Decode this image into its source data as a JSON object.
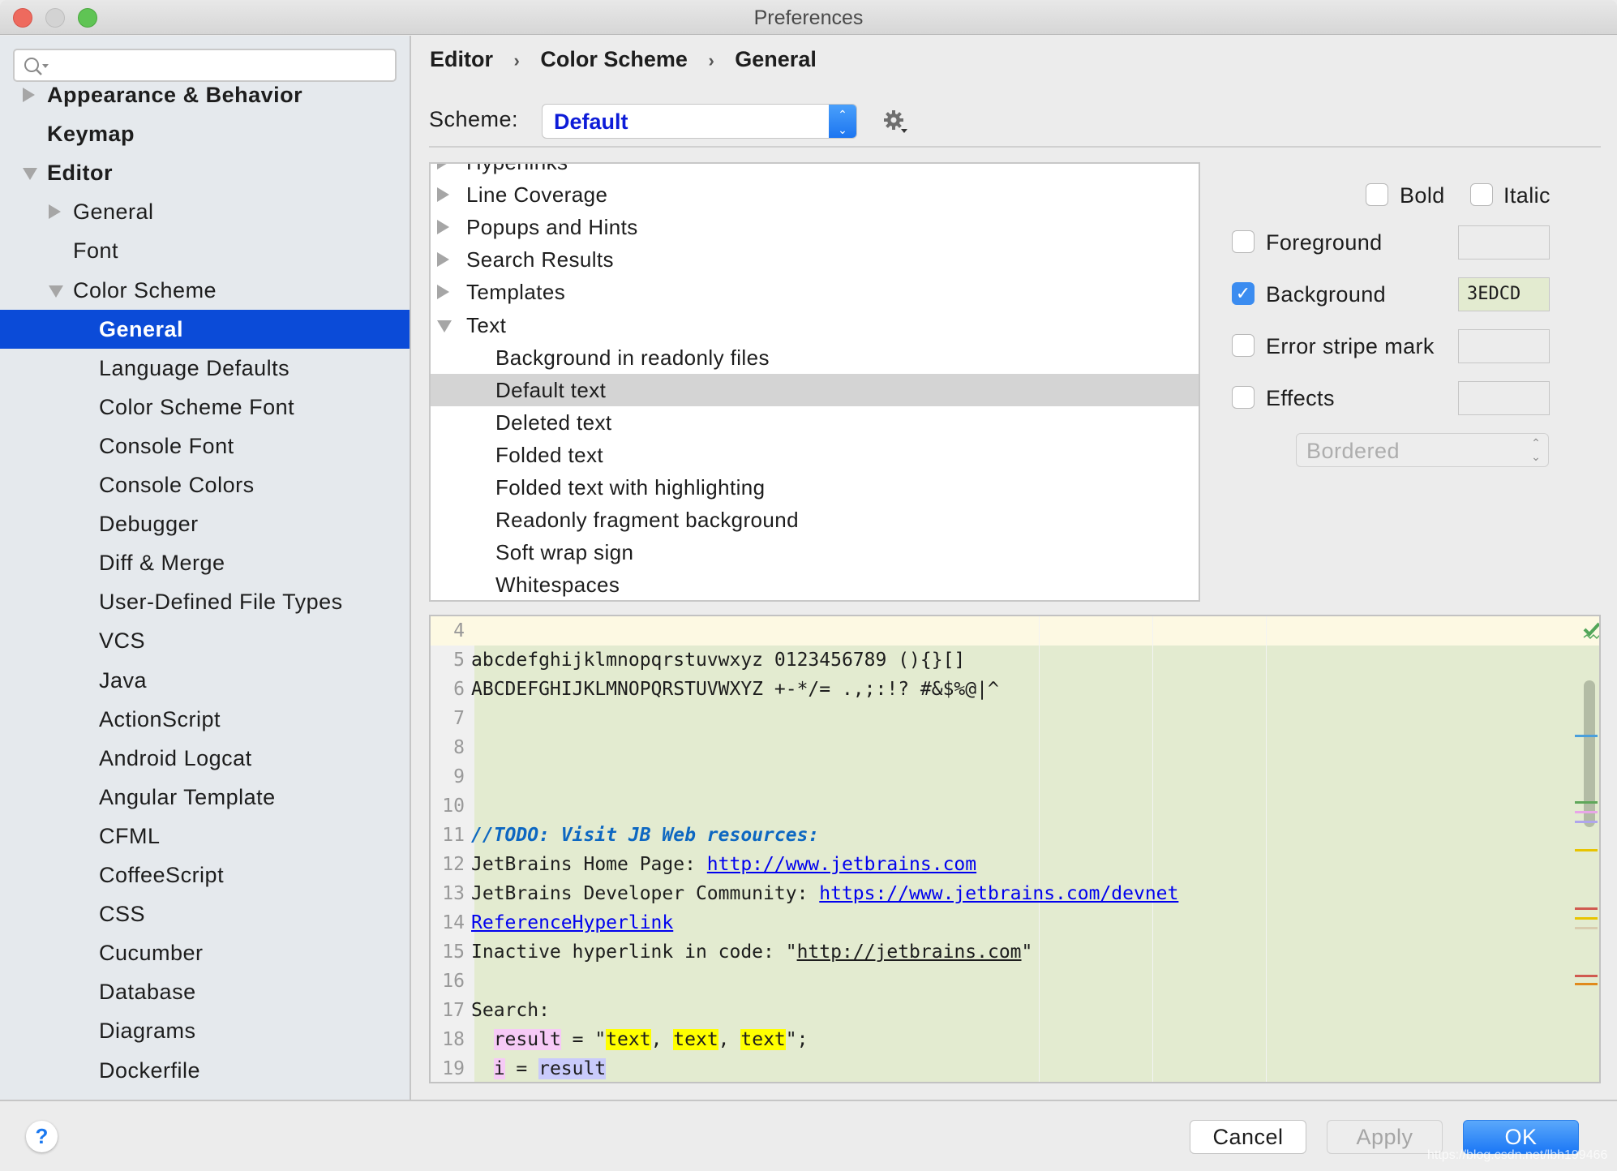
{
  "window": {
    "title": "Preferences",
    "traffic_lights": {
      "close": "#ee6a5e",
      "minimize": "#d3d3d3",
      "zoom": "#5fc454"
    }
  },
  "sidebar": {
    "search": {
      "placeholder": "",
      "value": "",
      "icon": "search-icon"
    },
    "items": [
      {
        "label": "Appearance & Behavior",
        "level": 0,
        "bold": true,
        "expander": "collapsed"
      },
      {
        "label": "Keymap",
        "level": 0,
        "bold": true,
        "expander": "none"
      },
      {
        "label": "Editor",
        "level": 0,
        "bold": true,
        "expander": "expanded"
      },
      {
        "label": "General",
        "level": 1,
        "bold": false,
        "expander": "collapsed"
      },
      {
        "label": "Font",
        "level": 1,
        "bold": false,
        "expander": "none"
      },
      {
        "label": "Color Scheme",
        "level": 1,
        "bold": false,
        "expander": "expanded"
      },
      {
        "label": "General",
        "level": 2,
        "bold": false,
        "expander": "none",
        "selected": true
      },
      {
        "label": "Language Defaults",
        "level": 2,
        "expander": "none"
      },
      {
        "label": "Color Scheme Font",
        "level": 2,
        "expander": "none"
      },
      {
        "label": "Console Font",
        "level": 2,
        "expander": "none"
      },
      {
        "label": "Console Colors",
        "level": 2,
        "expander": "none"
      },
      {
        "label": "Debugger",
        "level": 2,
        "expander": "none"
      },
      {
        "label": "Diff & Merge",
        "level": 2,
        "expander": "none"
      },
      {
        "label": "User-Defined File Types",
        "level": 2,
        "expander": "none"
      },
      {
        "label": "VCS",
        "level": 2,
        "expander": "none"
      },
      {
        "label": "Java",
        "level": 2,
        "expander": "none"
      },
      {
        "label": "ActionScript",
        "level": 2,
        "expander": "none"
      },
      {
        "label": "Android Logcat",
        "level": 2,
        "expander": "none"
      },
      {
        "label": "Angular Template",
        "level": 2,
        "expander": "none"
      },
      {
        "label": "CFML",
        "level": 2,
        "expander": "none"
      },
      {
        "label": "CoffeeScript",
        "level": 2,
        "expander": "none"
      },
      {
        "label": "CSS",
        "level": 2,
        "expander": "none"
      },
      {
        "label": "Cucumber",
        "level": 2,
        "expander": "none"
      },
      {
        "label": "Database",
        "level": 2,
        "expander": "none"
      },
      {
        "label": "Diagrams",
        "level": 2,
        "expander": "none"
      },
      {
        "label": "Dockerfile",
        "level": 2,
        "expander": "none"
      }
    ],
    "selected_color": "#0b4bd8"
  },
  "breadcrumb": [
    "Editor",
    "Color Scheme",
    "General"
  ],
  "breadcrumb_separator": "›",
  "scheme": {
    "label": "Scheme:",
    "value": "Default",
    "value_color": "#0d1cd8"
  },
  "tree": {
    "rows": [
      {
        "label": "Hyperlinks",
        "level": 0,
        "expander": "collapsed",
        "partial": true
      },
      {
        "label": "Line Coverage",
        "level": 0,
        "expander": "collapsed"
      },
      {
        "label": "Popups and Hints",
        "level": 0,
        "expander": "collapsed"
      },
      {
        "label": "Search Results",
        "level": 0,
        "expander": "collapsed"
      },
      {
        "label": "Templates",
        "level": 0,
        "expander": "collapsed"
      },
      {
        "label": "Text",
        "level": 0,
        "expander": "expanded"
      },
      {
        "label": "Background in readonly files",
        "level": 1
      },
      {
        "label": "Default text",
        "level": 1,
        "selected": true
      },
      {
        "label": "Deleted text",
        "level": 1
      },
      {
        "label": "Folded text",
        "level": 1
      },
      {
        "label": "Folded text with highlighting",
        "level": 1
      },
      {
        "label": "Readonly fragment background",
        "level": 1
      },
      {
        "label": "Soft wrap sign",
        "level": 1
      },
      {
        "label": "Whitespaces",
        "level": 1
      }
    ]
  },
  "properties": {
    "bold": {
      "label": "Bold",
      "checked": false
    },
    "italic": {
      "label": "Italic",
      "checked": false
    },
    "foreground": {
      "label": "Foreground",
      "checked": false,
      "value": ""
    },
    "background": {
      "label": "Background",
      "checked": true,
      "value": "3EDCD",
      "color": "#e3ebd0"
    },
    "error_stripe": {
      "label": "Error stripe mark",
      "checked": false,
      "value": ""
    },
    "effects": {
      "label": "Effects",
      "checked": false,
      "value": ""
    },
    "effect_type": {
      "value": "Bordered",
      "disabled": true
    }
  },
  "preview": {
    "background": "#e3ebd0",
    "current_line_bg": "#fdf9e3",
    "lines": [
      {
        "n": "4",
        "segments": []
      },
      {
        "n": "5",
        "segments": [
          {
            "t": "abcdefghijklmnopqrstuvwxyz 0123456789 (){}[]",
            "s": ""
          }
        ]
      },
      {
        "n": "6",
        "segments": [
          {
            "t": "ABCDEFGHIJKLMNOPQRSTUVWXYZ +-*/= .,;:!? #&$%@|^",
            "s": ""
          }
        ]
      },
      {
        "n": "7",
        "segments": []
      },
      {
        "n": "8",
        "segments": []
      },
      {
        "n": "9",
        "segments": []
      },
      {
        "n": "10",
        "segments": []
      },
      {
        "n": "11",
        "segments": [
          {
            "t": "//TODO: Visit JB Web resources:",
            "s": "todo"
          }
        ]
      },
      {
        "n": "12",
        "segments": [
          {
            "t": "JetBrains Home Page: ",
            "s": ""
          },
          {
            "t": "http://www.jetbrains.com",
            "s": "lnk"
          }
        ]
      },
      {
        "n": "13",
        "segments": [
          {
            "t": "JetBrains Developer Community: ",
            "s": ""
          },
          {
            "t": "https://www.jetbrains.com/devnet",
            "s": "lnk"
          }
        ]
      },
      {
        "n": "14",
        "segments": [
          {
            "t": "ReferenceHyperlink",
            "s": "lnk"
          }
        ]
      },
      {
        "n": "15",
        "segments": [
          {
            "t": "Inactive hyperlink in code: \"",
            "s": ""
          },
          {
            "t": "http://jetbrains.com",
            "s": "ilnk"
          },
          {
            "t": "\"",
            "s": ""
          }
        ]
      },
      {
        "n": "16",
        "segments": []
      },
      {
        "n": "17",
        "segments": [
          {
            "t": "Search:",
            "s": ""
          }
        ]
      },
      {
        "n": "18",
        "segments": [
          {
            "t": "  ",
            "s": ""
          },
          {
            "t": "result",
            "s": "hl-p"
          },
          {
            "t": " = \"",
            "s": ""
          },
          {
            "t": "text",
            "s": "hl-y"
          },
          {
            "t": ", ",
            "s": ""
          },
          {
            "t": "text",
            "s": "hl-y"
          },
          {
            "t": ", ",
            "s": ""
          },
          {
            "t": "text",
            "s": "hl-y"
          },
          {
            "t": "\";",
            "s": ""
          }
        ]
      },
      {
        "n": "19",
        "segments": [
          {
            "t": "  ",
            "s": ""
          },
          {
            "t": "i",
            "s": "hl-p"
          },
          {
            "t": " = ",
            "s": ""
          },
          {
            "t": "result",
            "s": "hl-b"
          }
        ]
      }
    ],
    "status_icon": "inspection-ok-icon",
    "stripe_marks": [
      "#4a9fdc",
      "#5fa75a",
      "#e8a6e8",
      "#b0a5ec",
      "#e8c400",
      "#d05a50",
      "#e8c400",
      "#d8ccae",
      "#d05a50",
      "#e08a1c"
    ]
  },
  "footer": {
    "help": "?",
    "cancel": "Cancel",
    "apply": "Apply",
    "ok": "OK",
    "watermark": "https://blog.csdn.net/lbh199466"
  }
}
